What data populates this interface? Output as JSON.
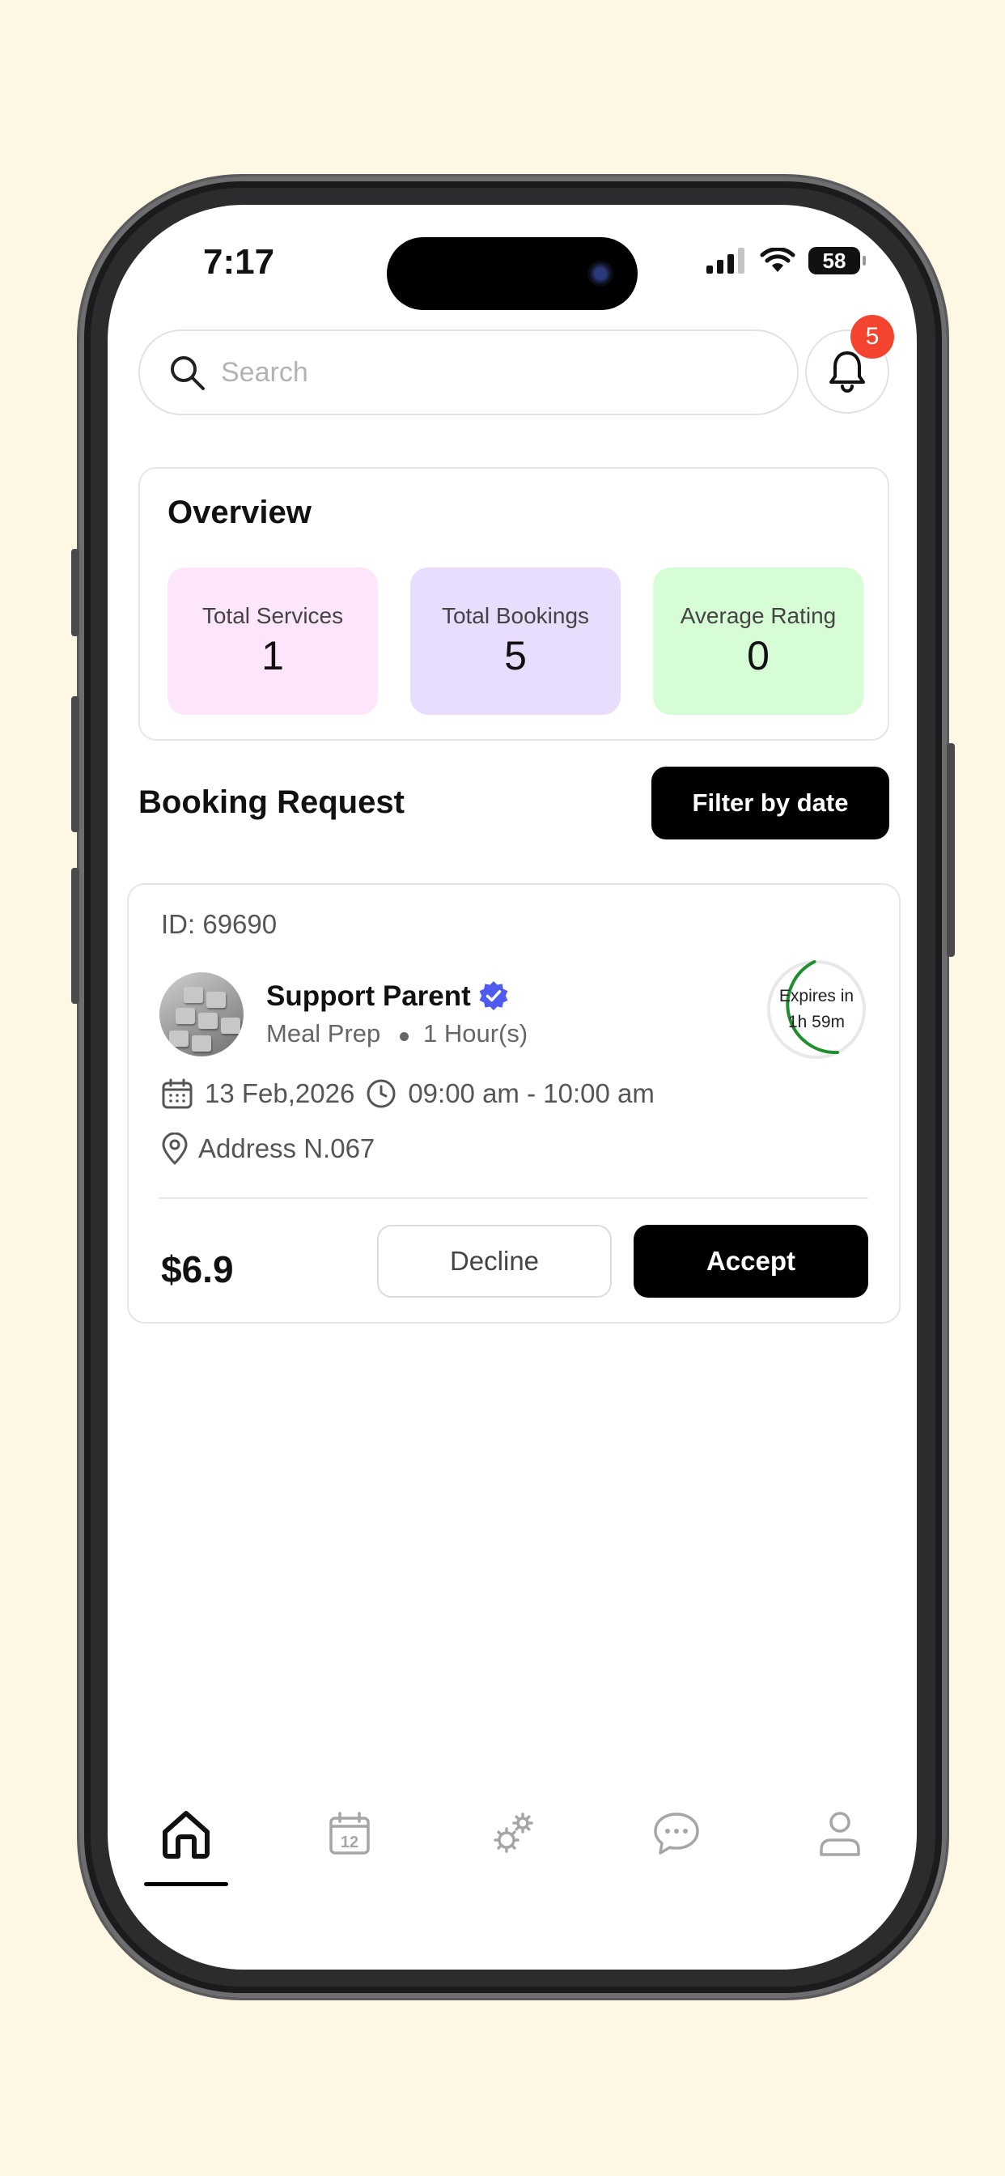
{
  "status_bar": {
    "time": "7:17",
    "battery": "58"
  },
  "search": {
    "placeholder": "Search"
  },
  "notifications": {
    "count": "5"
  },
  "overview": {
    "title": "Overview",
    "stats": [
      {
        "label": "Total Services",
        "value": "1",
        "color": "#FDE6FB"
      },
      {
        "label": "Total Bookings",
        "value": "5",
        "color": "#E8DDFD"
      },
      {
        "label": "Average Rating",
        "value": "0",
        "color": "#D6FDD6"
      }
    ]
  },
  "booking_section": {
    "title": "Booking Request",
    "filter_label": "Filter by date"
  },
  "booking": {
    "id": "ID: 69690",
    "service_name": "Support Parent",
    "category": "Meal Prep",
    "duration": "1 Hour(s)",
    "expires_label": "Expires in",
    "expires_value": "1h 59m",
    "date": "13 Feb,2026",
    "time_range": "09:00 am - 10:00 am",
    "address": "Address N.067",
    "price": "$6.9",
    "decline_label": "Decline",
    "accept_label": "Accept"
  },
  "tab_bar": {
    "active": "home",
    "calendar_day": "12",
    "items": [
      "home-icon",
      "calendar-icon",
      "services-icon",
      "chat-icon",
      "profile-icon"
    ]
  },
  "colors": {
    "background": "#FDF7E4",
    "accent": "#000000",
    "badge": "#F4432F",
    "verified": "#4F5BF0",
    "timer_ring": "#1E8E2E"
  }
}
